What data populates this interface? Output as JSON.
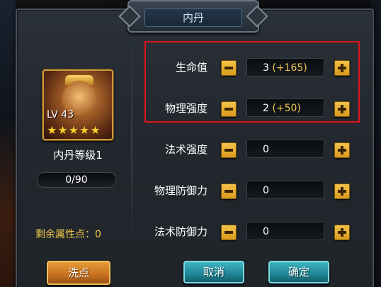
{
  "title": "内丹",
  "hero": {
    "level_label": "LV 43",
    "stars": 5,
    "dan_level": "内丹等级1",
    "exp": "0/90",
    "exp_fraction": 0
  },
  "remaining_points_label": "剩余属性点：0",
  "buttons": {
    "reset": "洗点",
    "cancel": "取消",
    "confirm": "确定"
  },
  "stats": [
    {
      "label": "生命值",
      "value": "3",
      "bonus": "(+165)"
    },
    {
      "label": "物理强度",
      "value": "2",
      "bonus": "(+50)"
    },
    {
      "label": "法术强度",
      "value": "0",
      "bonus": ""
    },
    {
      "label": "物理防御力",
      "value": "0",
      "bonus": ""
    },
    {
      "label": "法术防御力",
      "value": "0",
      "bonus": ""
    }
  ],
  "colors": {
    "highlight_border": "#e0141b",
    "bonus_text": "#f2c94c",
    "remaining_text": "#f2c94c",
    "reset_button": "#c6701f",
    "action_button": "#1f8594"
  }
}
